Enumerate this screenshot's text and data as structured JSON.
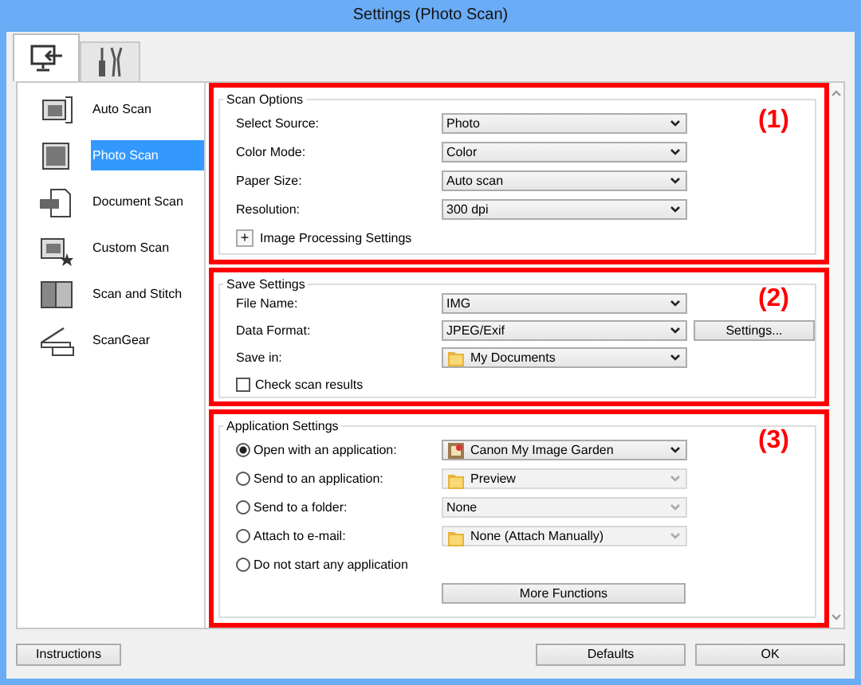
{
  "window": {
    "title": "Settings (Photo Scan)"
  },
  "tabs": [
    {
      "kind": "scan",
      "selected": true
    },
    {
      "kind": "tools",
      "selected": false
    }
  ],
  "sidebar": {
    "items": [
      {
        "label": "Auto Scan",
        "kind": "auto",
        "selected": false
      },
      {
        "label": "Photo Scan",
        "kind": "photo",
        "selected": true
      },
      {
        "label": "Document Scan",
        "kind": "document",
        "selected": false
      },
      {
        "label": "Custom Scan",
        "kind": "custom",
        "selected": false
      },
      {
        "label": "Scan and Stitch",
        "kind": "stitch",
        "selected": false
      },
      {
        "label": "ScanGear",
        "kind": "scangear",
        "selected": false
      }
    ]
  },
  "sections": [
    {
      "marker": "(1)",
      "title": "Scan Options",
      "fields": [
        {
          "label": "Select Source:",
          "value": "Photo"
        },
        {
          "label": "Color Mode:",
          "value": "Color"
        },
        {
          "label": "Paper Size:",
          "value": "Auto scan"
        },
        {
          "label": "Resolution:",
          "value": "300 dpi"
        }
      ],
      "expander": {
        "sign": "+",
        "label": "Image Processing Settings",
        "expanded": false
      }
    },
    {
      "marker": "(2)",
      "title": "Save Settings",
      "fields": [
        {
          "label": "File Name:",
          "value": "IMG"
        },
        {
          "label": "Data Format:",
          "value": "JPEG/Exif",
          "button": "Settings..."
        },
        {
          "label": "Save in:",
          "value": "My Documents",
          "kind": "folder"
        }
      ],
      "checkbox": {
        "label": "Check scan results",
        "checked": false
      }
    },
    {
      "marker": "(3)",
      "title": "Application Settings",
      "options": [
        {
          "label": "Open with an application:",
          "selected": true,
          "dropdown": {
            "value": "Canon My Image Garden",
            "kind": "app",
            "disabled": false
          }
        },
        {
          "label": "Send to an application:",
          "selected": false,
          "dropdown": {
            "value": "Preview",
            "kind": "folder",
            "disabled": true
          }
        },
        {
          "label": "Send to a folder:",
          "selected": false,
          "dropdown": {
            "value": "None",
            "disabled": true
          }
        },
        {
          "label": "Attach to e-mail:",
          "selected": false,
          "dropdown": {
            "value": "None (Attach Manually)",
            "kind": "folder",
            "disabled": true
          }
        },
        {
          "label": "Do not start any application",
          "selected": false
        }
      ],
      "button": "More Functions"
    }
  ],
  "footer": {
    "left": [
      "Instructions"
    ],
    "right": [
      "Defaults",
      "OK"
    ]
  }
}
